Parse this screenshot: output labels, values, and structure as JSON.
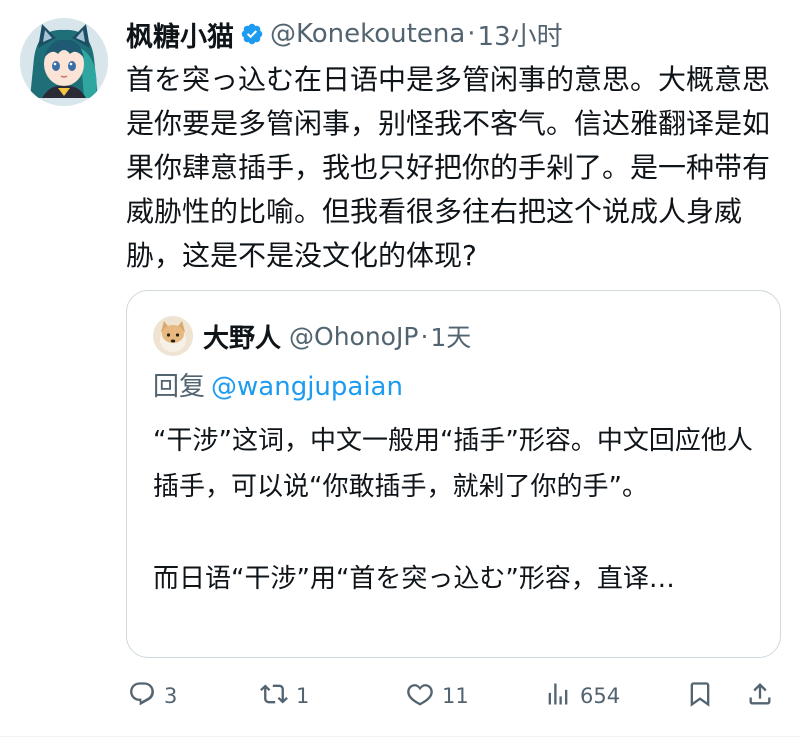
{
  "author": {
    "display_name": "枫糖小猫",
    "handle": "@Konekoutena",
    "separator": "·",
    "time": "13小时",
    "verified_icon": "verified-badge-icon"
  },
  "body": {
    "text": "首を突っ込むᅟ在日语中是多管闲事的意思。大概意思是你要是多管闲事，别怪我不客气。信达雅翻译是如果你肆意插手，我也只好把你的手剁了。是一种带有威胁性的比喻。但我看很多往右把这个说成人身威胁，这是不是没文化的体现?"
  },
  "quote": {
    "display_name": "大野人",
    "handle": "@OhonoJP",
    "separator": "·",
    "time": "1天",
    "reply_prefix": "回复",
    "reply_mention": "@wangjupaian",
    "paragraph1": "“干涉”这词，中文一般用“插手”形容。中文回应他人插手，可以说“你敢插手，就剁了你的手”。",
    "paragraph2": "而日语“干涉”用“首を突っ込む”形容，直译…"
  },
  "actions": {
    "reply_count": "3",
    "retweet_count": "1",
    "like_count": "11",
    "views_count": "654",
    "colors": {
      "icon": "#536471"
    }
  },
  "colors": {
    "link": "#1d9bf0",
    "text": "#0f1419",
    "secondary": "#536471",
    "border": "#cfd9de"
  }
}
